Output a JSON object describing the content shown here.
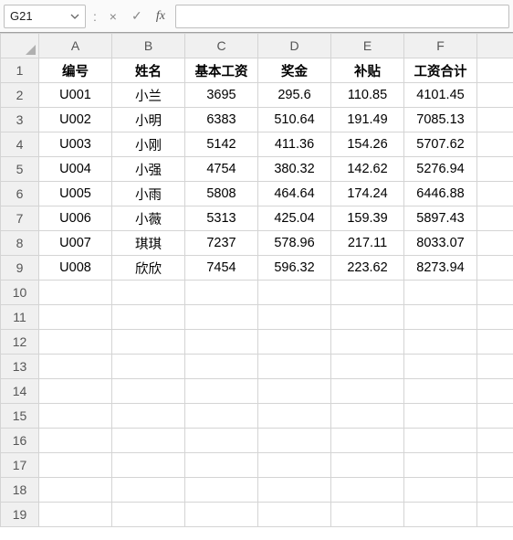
{
  "formula_bar": {
    "name_box": "G21",
    "separator": ":",
    "cancel_glyph": "×",
    "confirm_glyph": "✓",
    "fx_label": "fx",
    "formula_value": ""
  },
  "columns": [
    "A",
    "B",
    "C",
    "D",
    "E",
    "F",
    ""
  ],
  "row_numbers": [
    "1",
    "2",
    "3",
    "4",
    "5",
    "6",
    "7",
    "8",
    "9",
    "10",
    "11",
    "12",
    "13",
    "14",
    "15",
    "16",
    "17",
    "18",
    "19"
  ],
  "chart_data": {
    "type": "table",
    "headers": [
      "编号",
      "姓名",
      "基本工资",
      "奖金",
      "补贴",
      "工资合计"
    ],
    "rows": [
      [
        "U001",
        "小兰",
        "3695",
        "295.6",
        "110.85",
        "4101.45"
      ],
      [
        "U002",
        "小明",
        "6383",
        "510.64",
        "191.49",
        "7085.13"
      ],
      [
        "U003",
        "小刚",
        "5142",
        "411.36",
        "154.26",
        "5707.62"
      ],
      [
        "U004",
        "小强",
        "4754",
        "380.32",
        "142.62",
        "5276.94"
      ],
      [
        "U005",
        "小雨",
        "5808",
        "464.64",
        "174.24",
        "6446.88"
      ],
      [
        "U006",
        "小薇",
        "5313",
        "425.04",
        "159.39",
        "5897.43"
      ],
      [
        "U007",
        "琪琪",
        "7237",
        "578.96",
        "217.11",
        "8033.07"
      ],
      [
        "U008",
        "欣欣",
        "7454",
        "596.32",
        "223.62",
        "8273.94"
      ]
    ]
  }
}
